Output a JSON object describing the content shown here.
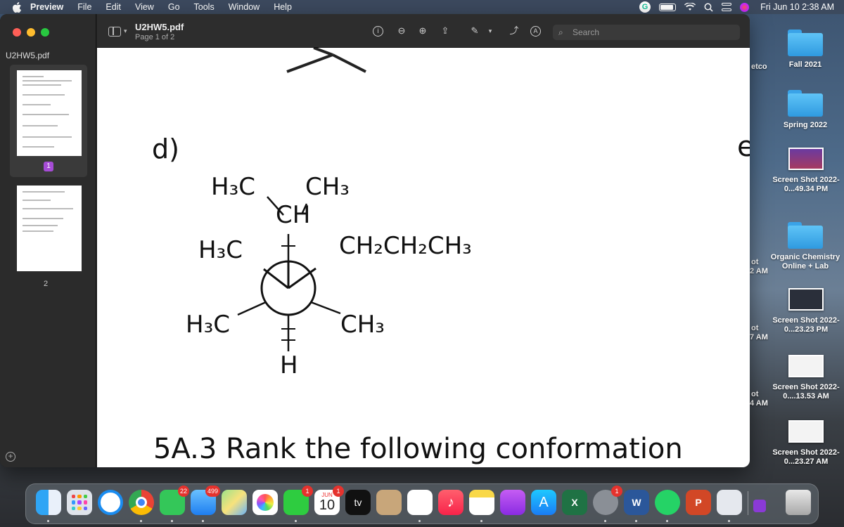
{
  "menubar": {
    "app_name": "Preview",
    "menus": [
      "File",
      "Edit",
      "View",
      "Go",
      "Tools",
      "Window",
      "Help"
    ],
    "clock": "Fri Jun 10  2:38 AM"
  },
  "window": {
    "doc_title": "U2HW5.pdf",
    "doc_subtitle": "Page 1 of 2",
    "sidebar_title": "U2HW5.pdf",
    "page_badge": "1",
    "page2_label": "2",
    "search_placeholder": "Search"
  },
  "document": {
    "part_label": "d)",
    "groups": {
      "top_left": "H₃C",
      "top_right": "CH₃",
      "front_carbon": "CH",
      "mid_left": "H₃C",
      "mid_right": "CH₂CH₂CH₃",
      "low_left": "H₃C",
      "low_right": "CH₃",
      "bottom": "H"
    },
    "caption": "5A.3 Rank the following conformation"
  },
  "desktop_icons": [
    {
      "label": "Fall 2021",
      "kind": "folder"
    },
    {
      "label": "Spring 2022",
      "kind": "folder"
    },
    {
      "label": "Screen Shot 2022-0...49.34 PM",
      "kind": "shot"
    },
    {
      "label": "Organic Chemistry Online + Lab",
      "kind": "folder"
    },
    {
      "label": "Screen Shot 2022-0...23.23 PM",
      "kind": "shot"
    },
    {
      "label": "Screen Shot 2022-0....13.53 AM",
      "kind": "shot"
    },
    {
      "label": "Screen Shot 2022-0...23.27 AM",
      "kind": "shot"
    }
  ],
  "desktop_partial_labels": [
    "etco",
    "ot",
    "2 AM",
    "ot",
    "7 AM",
    "ot",
    "4 AM"
  ],
  "dock": {
    "badges": {
      "messages": "22",
      "mail": "499",
      "facetime": "1",
      "calendar_month": "JUN",
      "calendar_day": "10",
      "calendar_badge": "1",
      "system_prefs": "1"
    },
    "tv_label": "tv"
  },
  "colors": {
    "accent": "#a64cd6",
    "badge": "#e5322d",
    "folder": "#3aa3e8"
  }
}
